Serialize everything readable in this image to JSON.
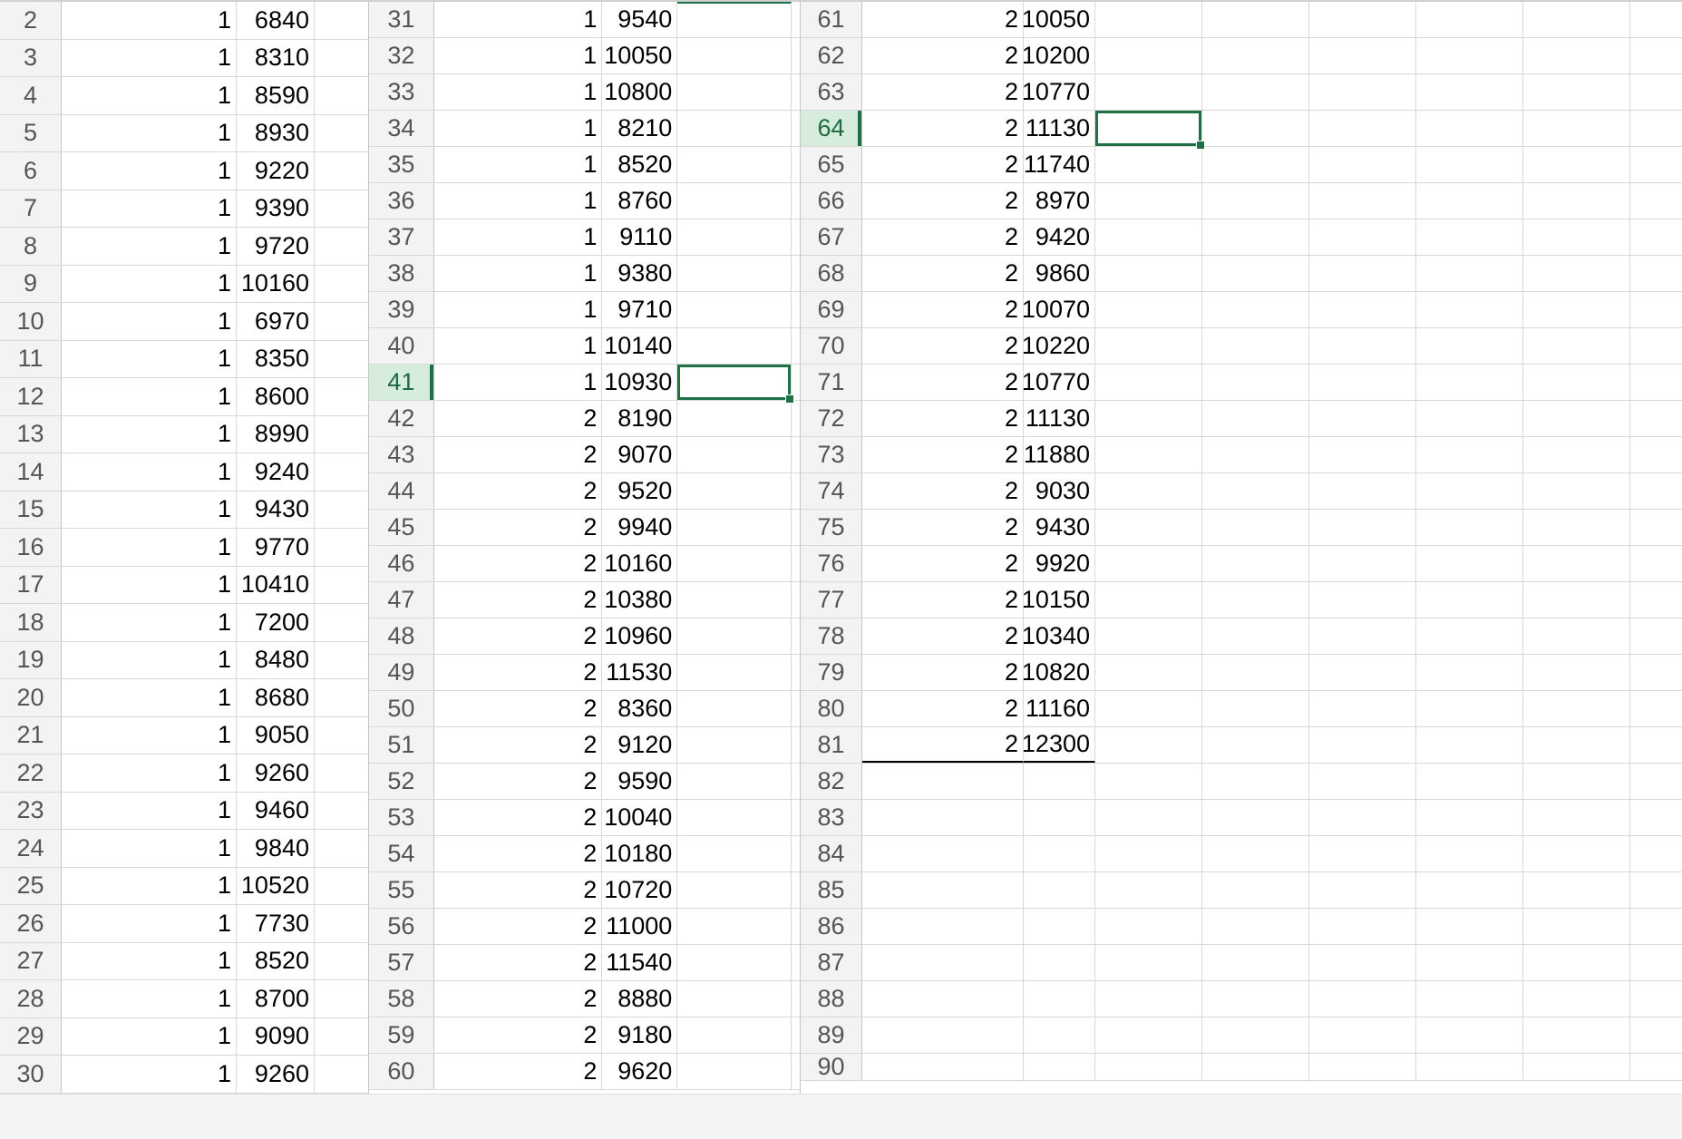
{
  "spreadsheet": {
    "panes": [
      {
        "rows": [
          {
            "n": "2",
            "a": "1",
            "b": "6840"
          },
          {
            "n": "3",
            "a": "1",
            "b": "8310"
          },
          {
            "n": "4",
            "a": "1",
            "b": "8590"
          },
          {
            "n": "5",
            "a": "1",
            "b": "8930"
          },
          {
            "n": "6",
            "a": "1",
            "b": "9220"
          },
          {
            "n": "7",
            "a": "1",
            "b": "9390"
          },
          {
            "n": "8",
            "a": "1",
            "b": "9720"
          },
          {
            "n": "9",
            "a": "1",
            "b": "10160"
          },
          {
            "n": "10",
            "a": "1",
            "b": "6970"
          },
          {
            "n": "11",
            "a": "1",
            "b": "8350"
          },
          {
            "n": "12",
            "a": "1",
            "b": "8600"
          },
          {
            "n": "13",
            "a": "1",
            "b": "8990"
          },
          {
            "n": "14",
            "a": "1",
            "b": "9240"
          },
          {
            "n": "15",
            "a": "1",
            "b": "9430"
          },
          {
            "n": "16",
            "a": "1",
            "b": "9770"
          },
          {
            "n": "17",
            "a": "1",
            "b": "10410"
          },
          {
            "n": "18",
            "a": "1",
            "b": "7200"
          },
          {
            "n": "19",
            "a": "1",
            "b": "8480"
          },
          {
            "n": "20",
            "a": "1",
            "b": "8680"
          },
          {
            "n": "21",
            "a": "1",
            "b": "9050"
          },
          {
            "n": "22",
            "a": "1",
            "b": "9260"
          },
          {
            "n": "23",
            "a": "1",
            "b": "9460"
          },
          {
            "n": "24",
            "a": "1",
            "b": "9840"
          },
          {
            "n": "25",
            "a": "1",
            "b": "10520"
          },
          {
            "n": "26",
            "a": "1",
            "b": "7730"
          },
          {
            "n": "27",
            "a": "1",
            "b": "8520"
          },
          {
            "n": "28",
            "a": "1",
            "b": "8700"
          },
          {
            "n": "29",
            "a": "1",
            "b": "9090"
          },
          {
            "n": "30",
            "a": "1",
            "b": "9260"
          }
        ]
      },
      {
        "rows": [
          {
            "n": "31",
            "a": "1",
            "b": "9540"
          },
          {
            "n": "32",
            "a": "1",
            "b": "10050"
          },
          {
            "n": "33",
            "a": "1",
            "b": "10800"
          },
          {
            "n": "34",
            "a": "1",
            "b": "8210"
          },
          {
            "n": "35",
            "a": "1",
            "b": "8520"
          },
          {
            "n": "36",
            "a": "1",
            "b": "8760"
          },
          {
            "n": "37",
            "a": "1",
            "b": "9110"
          },
          {
            "n": "38",
            "a": "1",
            "b": "9380"
          },
          {
            "n": "39",
            "a": "1",
            "b": "9710"
          },
          {
            "n": "40",
            "a": "1",
            "b": "10140"
          },
          {
            "n": "41",
            "a": "1",
            "b": "10930"
          },
          {
            "n": "42",
            "a": "2",
            "b": "8190"
          },
          {
            "n": "43",
            "a": "2",
            "b": "9070"
          },
          {
            "n": "44",
            "a": "2",
            "b": "9520"
          },
          {
            "n": "45",
            "a": "2",
            "b": "9940"
          },
          {
            "n": "46",
            "a": "2",
            "b": "10160"
          },
          {
            "n": "47",
            "a": "2",
            "b": "10380"
          },
          {
            "n": "48",
            "a": "2",
            "b": "10960"
          },
          {
            "n": "49",
            "a": "2",
            "b": "11530"
          },
          {
            "n": "50",
            "a": "2",
            "b": "8360"
          },
          {
            "n": "51",
            "a": "2",
            "b": "9120"
          },
          {
            "n": "52",
            "a": "2",
            "b": "9590"
          },
          {
            "n": "53",
            "a": "2",
            "b": "10040"
          },
          {
            "n": "54",
            "a": "2",
            "b": "10180"
          },
          {
            "n": "55",
            "a": "2",
            "b": "10720"
          },
          {
            "n": "56",
            "a": "2",
            "b": "11000"
          },
          {
            "n": "57",
            "a": "2",
            "b": "11540"
          },
          {
            "n": "58",
            "a": "2",
            "b": "8880"
          },
          {
            "n": "59",
            "a": "2",
            "b": "9180"
          },
          {
            "n": "60",
            "a": "2",
            "b": "9620"
          }
        ]
      },
      {
        "rows": [
          {
            "n": "61",
            "a": "2",
            "b": "10050"
          },
          {
            "n": "62",
            "a": "2",
            "b": "10200"
          },
          {
            "n": "63",
            "a": "2",
            "b": "10770"
          },
          {
            "n": "64",
            "a": "2",
            "b": "11130"
          },
          {
            "n": "65",
            "a": "2",
            "b": "11740"
          },
          {
            "n": "66",
            "a": "2",
            "b": "8970"
          },
          {
            "n": "67",
            "a": "2",
            "b": "9420"
          },
          {
            "n": "68",
            "a": "2",
            "b": "9860"
          },
          {
            "n": "69",
            "a": "2",
            "b": "10070"
          },
          {
            "n": "70",
            "a": "2",
            "b": "10220"
          },
          {
            "n": "71",
            "a": "2",
            "b": "10770"
          },
          {
            "n": "72",
            "a": "2",
            "b": "11130"
          },
          {
            "n": "73",
            "a": "2",
            "b": "11880"
          },
          {
            "n": "74",
            "a": "2",
            "b": "9030"
          },
          {
            "n": "75",
            "a": "2",
            "b": "9430"
          },
          {
            "n": "76",
            "a": "2",
            "b": "9920"
          },
          {
            "n": "77",
            "a": "2",
            "b": "10150"
          },
          {
            "n": "78",
            "a": "2",
            "b": "10340"
          },
          {
            "n": "79",
            "a": "2",
            "b": "10820"
          },
          {
            "n": "80",
            "a": "2",
            "b": "11160"
          },
          {
            "n": "81",
            "a": "2",
            "b": "12300"
          },
          {
            "n": "82",
            "a": "",
            "b": ""
          },
          {
            "n": "83",
            "a": "",
            "b": ""
          },
          {
            "n": "84",
            "a": "",
            "b": ""
          },
          {
            "n": "85",
            "a": "",
            "b": ""
          },
          {
            "n": "86",
            "a": "",
            "b": ""
          },
          {
            "n": "87",
            "a": "",
            "b": ""
          },
          {
            "n": "88",
            "a": "",
            "b": ""
          },
          {
            "n": "89",
            "a": "",
            "b": ""
          },
          {
            "n": "90",
            "a": "",
            "b": ""
          }
        ]
      }
    ],
    "selected_rows": [
      "41",
      "64"
    ],
    "colors": {
      "selection": "#1e7145",
      "header_selected_bg": "#d6ecdd"
    }
  }
}
